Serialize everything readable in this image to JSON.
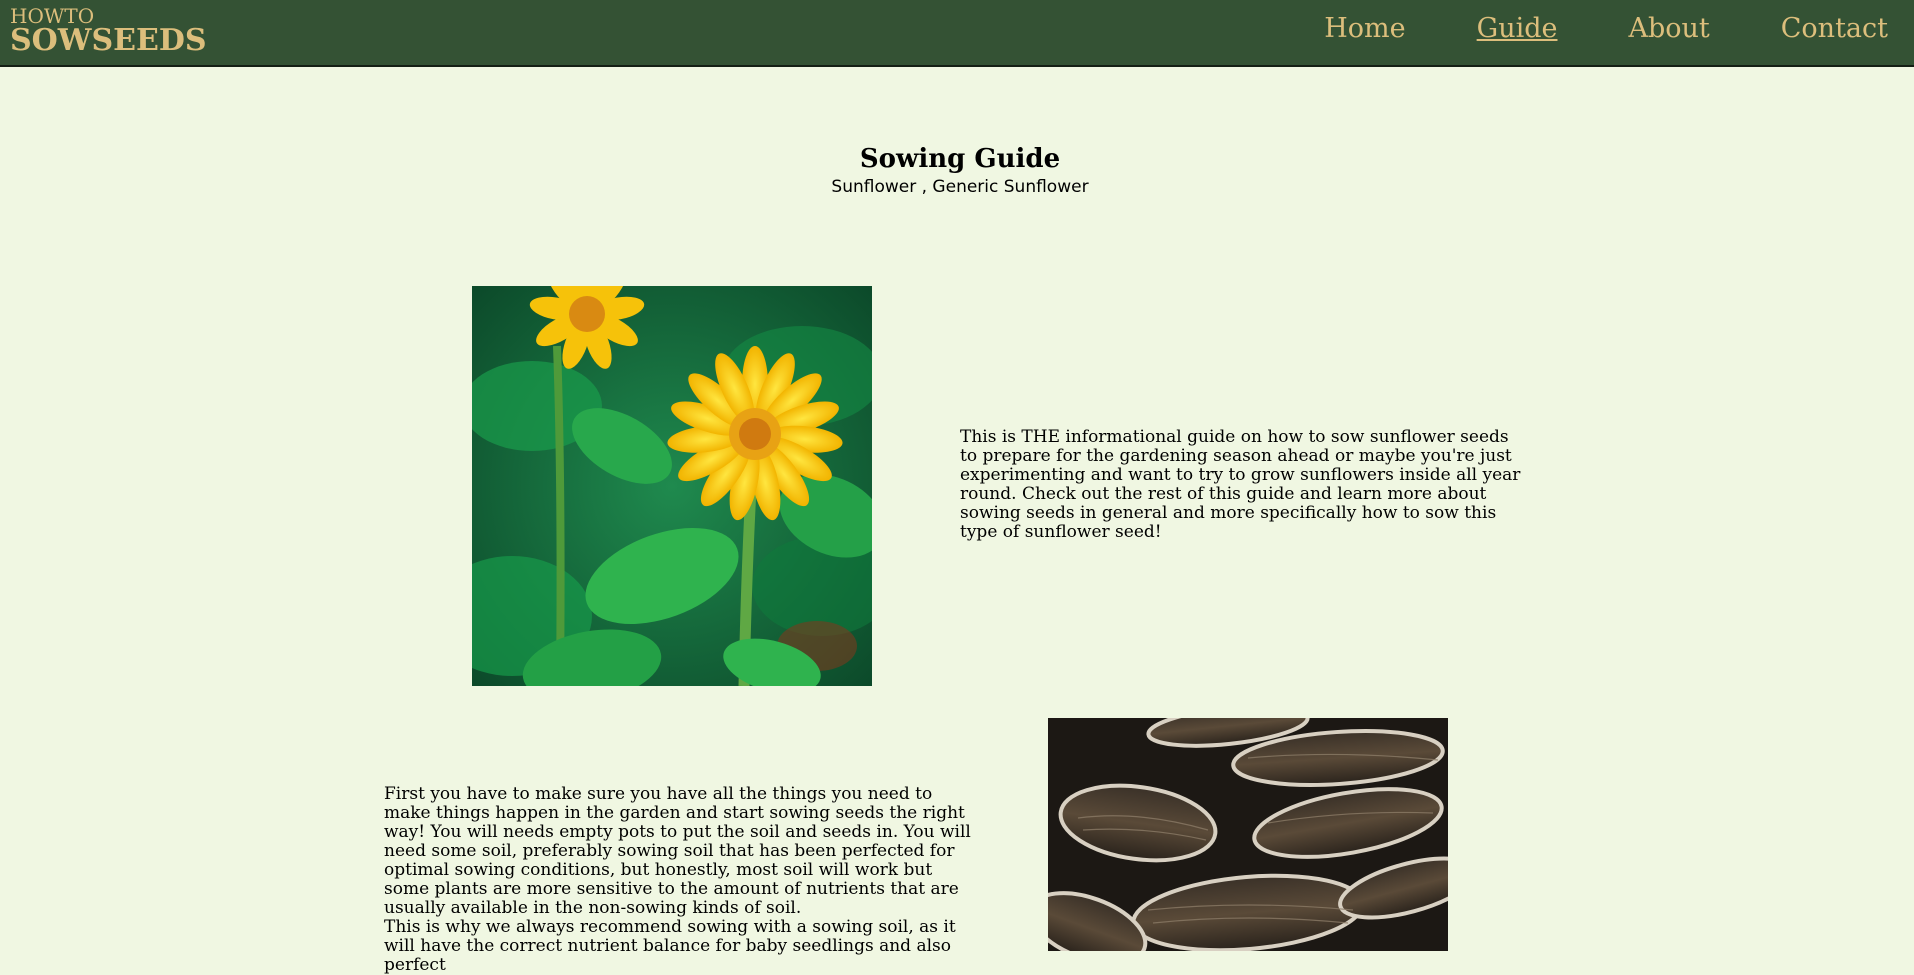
{
  "header": {
    "logo_small": "HOWTO",
    "logo_big": "SOWSEEDS",
    "nav": [
      {
        "label": "Home"
      },
      {
        "label": "Guide"
      },
      {
        "label": "About"
      },
      {
        "label": "Contact"
      }
    ],
    "active_nav": "Guide"
  },
  "main": {
    "title": "Sowing Guide",
    "subtitle": "Sunflower , Generic Sunflower",
    "intro_text": "This is THE informational guide on how to sow sunflower seeds to prepare for the gardening season ahead or maybe you're just experimenting and want to try to grow sunflowers inside all year round. Check out the rest of this guide and learn more about sowing seeds in general and more specifically how to sow this type of sunflower seed!",
    "second_text_1": "First you have to make sure you have all the things you need to make things happen in the garden and start sowing seeds the right way! You will needs empty pots to put the soil and seeds in. You will need some soil, preferably sowing soil that has been perfected for optimal sowing conditions, but honestly, most soil will work but some plants are more sensitive to the amount of nutrients that are usually available in the non-sowing kinds of soil.",
    "second_text_2": "This is why we always recommend sowing with a sowing soil, as it will have the correct nutrient balance for baby seedlings and also perfect"
  },
  "colors": {
    "page_background": "#f0f7e2",
    "navbar": "#345234",
    "nav_text": "#dcbe7c"
  }
}
